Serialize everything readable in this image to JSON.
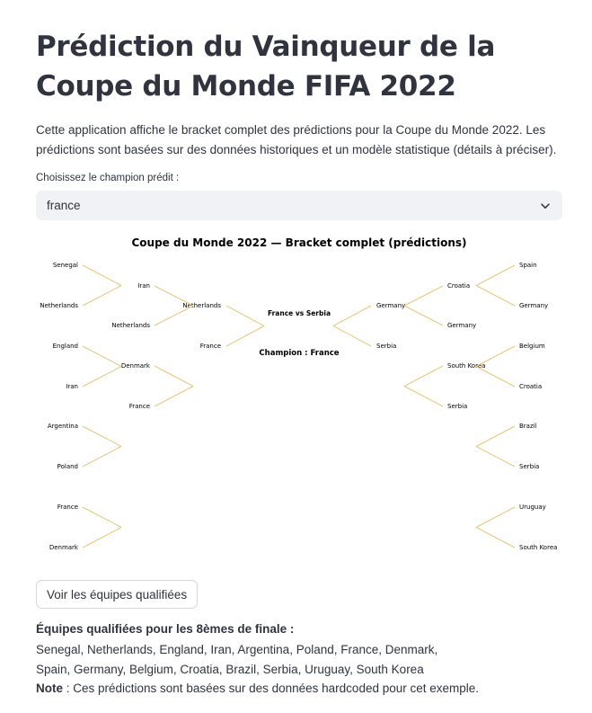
{
  "page": {
    "title": "Prédiction du Vainqueur de la Coupe du Monde FIFA 2022",
    "intro": "Cette application affiche le bracket complet des prédictions pour la Coupe du Monde 2022. Les prédictions sont basées sur des données historiques et un modèle statistique (détails à préciser).",
    "select_label": "Choisissez le champion prédit :",
    "select_value": "france",
    "button_label": "Voir les équipes qualifiées",
    "qualified_title": "Équipes qualifiées pour les 8èmes de finale :",
    "qualified_line1": "Senegal, Netherlands, England, Iran, Argentina, Poland, France, Denmark,",
    "qualified_line2": "Spain, Germany, Belgium, Croatia, Brazil, Serbia, Uruguay, South Korea",
    "note_label": "Note",
    "note_text": " : Ces prédictions sont basées sur des données hardcoded pour cet exemple."
  },
  "bracket": {
    "title": "Coupe du Monde 2022 — Bracket complet (prédictions)",
    "final_match": "France  vs  Serbia",
    "champion": "Champion : France",
    "line_color": "#e7c77f",
    "left": {
      "r16": [
        "Senegal",
        "Netherlands",
        "England",
        "Iran",
        "Argentina",
        "Poland",
        "France",
        "Denmark"
      ],
      "qf": [
        "Iran",
        "Netherlands",
        "Denmark",
        "France"
      ],
      "sf": [
        "Netherlands",
        "France"
      ]
    },
    "right": {
      "r16": [
        "Spain",
        "Germany",
        "Belgium",
        "Croatia",
        "Brazil",
        "Serbia",
        "Uruguay",
        "South Korea"
      ],
      "qf": [
        "Croatia",
        "Germany",
        "South Korea",
        "Serbia"
      ],
      "sf": [
        "Germany",
        "Serbia"
      ]
    }
  },
  "icons": {
    "select_chevron": "chevron-down-icon"
  }
}
